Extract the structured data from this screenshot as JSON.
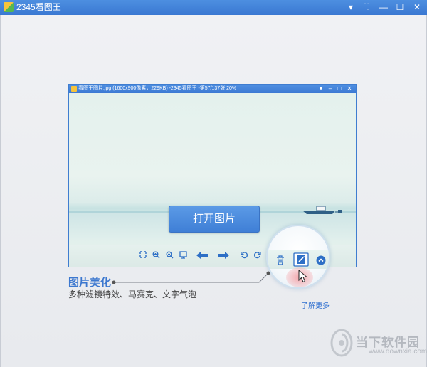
{
  "window": {
    "title": "2345看图王",
    "controls": {
      "menu": "▾",
      "fullscreen": "⛶",
      "minimize": "—",
      "maximize": "☐",
      "close": "✕"
    }
  },
  "preview": {
    "title": "看图王图片.jpg (1600x900像素，229KB) -2345看图王 -第57/137张 20%",
    "controls": {
      "menu": "▾",
      "minimize": "–",
      "maximize": "□",
      "close": "✕"
    },
    "open_button_label": "打开图片",
    "toolbar": [
      "actual-size",
      "zoom-in",
      "zoom-out",
      "fit-window",
      "previous",
      "next",
      "rotate-left",
      "rotate-right",
      "delete",
      "edit",
      "more"
    ]
  },
  "feature": {
    "title": "图片美化",
    "description": "多种滤镜特效、马赛克、文字气泡",
    "learn_more": "了解更多"
  },
  "watermark": {
    "name": "当下软件园",
    "url": "www.downxia.com"
  },
  "colors": {
    "accent": "#3c78cf",
    "titlebar": "#4182d6"
  }
}
